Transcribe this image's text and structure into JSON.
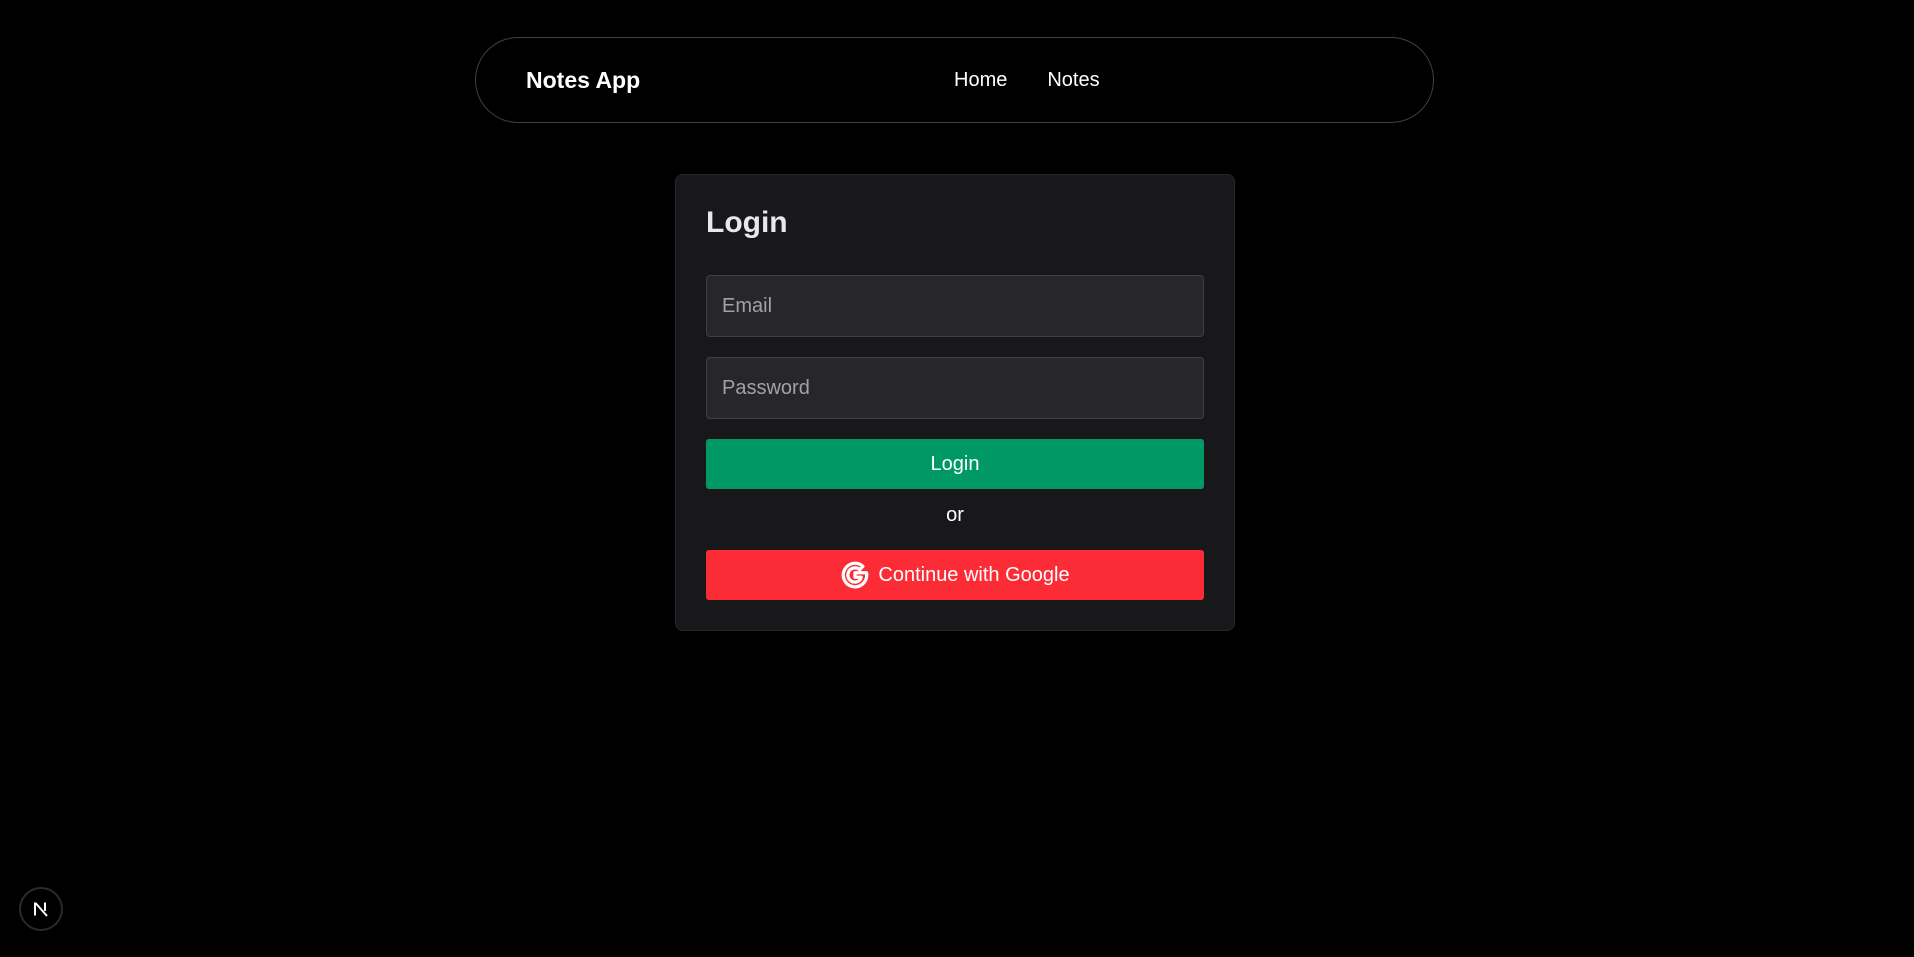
{
  "navbar": {
    "brand": "Notes App",
    "links": [
      {
        "label": "Home"
      },
      {
        "label": "Notes"
      }
    ]
  },
  "login_form": {
    "title": "Login",
    "email_placeholder": "Email",
    "password_placeholder": "Password",
    "login_button_label": "Login",
    "divider_text": "or",
    "google_button_label": "Continue with Google",
    "google_icon": "google-g-icon"
  },
  "dev_badge": {
    "icon": "nextjs-logo-icon"
  },
  "colors": {
    "page_background": "#000000",
    "card_background": "#18181b",
    "input_background": "#27272a",
    "login_button": "#009966",
    "google_button": "#fb2c36"
  }
}
